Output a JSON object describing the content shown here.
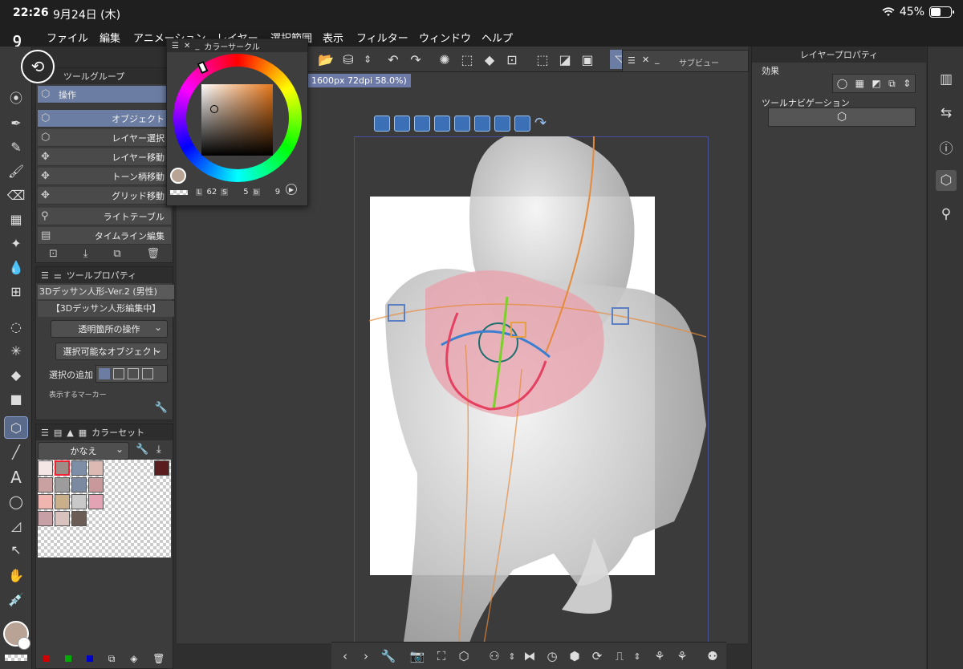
{
  "status": {
    "time": "22:26",
    "date": "9月24日 (木)",
    "battery": "45%"
  },
  "menu": [
    "ファイル",
    "編集",
    "アニメーション",
    "レイヤー",
    "選択範囲",
    "表示",
    "フィルター",
    "ウィンドウ",
    "ヘルプ"
  ],
  "tool_group": {
    "title": "ツールグループ",
    "selected_group": "操作",
    "items": [
      "オブジェクト",
      "レイヤー選択",
      "レイヤー移動",
      "トーン柄移動",
      "グリッド移動",
      "ライトテーブル",
      "タイムライン編集"
    ]
  },
  "color_circle": {
    "title": "カラーサークル",
    "l_label": "L",
    "l_value": "62",
    "s_label": "S",
    "s_value": "5",
    "b_label": "b",
    "b_value": "9"
  },
  "sub_view": {
    "title": "サブビュー"
  },
  "tool_property": {
    "title": "ツールプロパティ",
    "object_name": "3Dデッサン人形-Ver.2 (男性)",
    "editing": "【3Dデッサン人形編集中】",
    "transparent_op": "透明箇所の操作",
    "selectable": "選択可能なオブジェクト",
    "add_selection": "選択の追加",
    "display_mode": "表示するマーカー"
  },
  "color_set": {
    "title": "カラーセット",
    "set_name": "かなえ",
    "swatches": [
      "#f4e6e4",
      "#9e8c86",
      "#7d8fa6",
      "#dcb9b2",
      "#c9a1a0",
      "#9c9c9c",
      "#7b8aa0",
      "#c9989a",
      "#f0b5ae",
      "#c9b08a",
      "#c9c9c9",
      "#e3a3b5",
      "#c7a0a5",
      "#d9c2bd",
      "#6b5d56"
    ],
    "dark_swatch": "#5a1d1e"
  },
  "canvas": {
    "info": "1600px 72dpi 58.0%)"
  },
  "layer_property": {
    "title": "レイヤープロパティ",
    "effects_label": "効果",
    "tool_nav_label": "ツールナビゲーション"
  },
  "colors": {
    "main": "#b8a394",
    "accent": "#6c7da3"
  }
}
